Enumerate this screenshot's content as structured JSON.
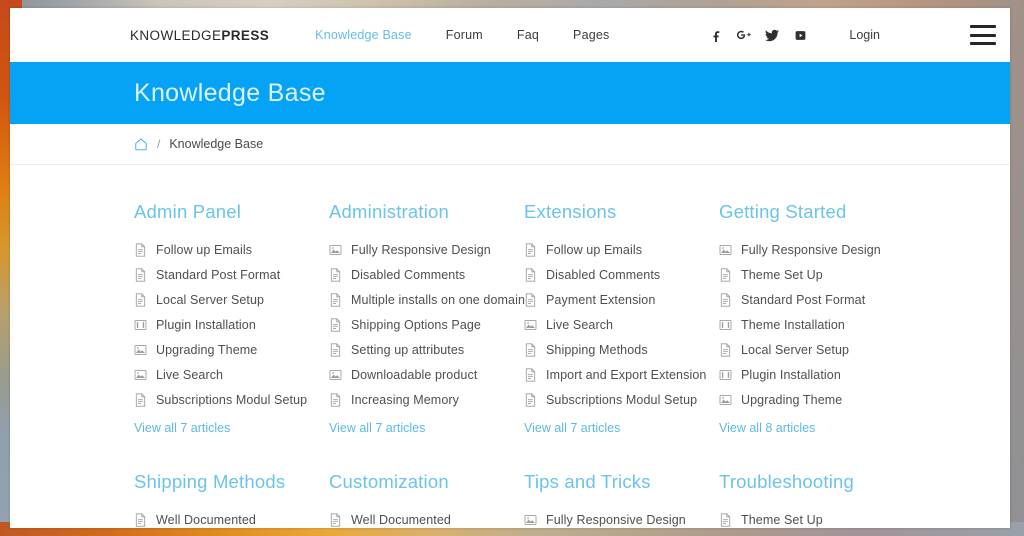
{
  "site": {
    "brand_light": "KNOWLEDGE",
    "brand_bold": "PRESS",
    "nav": [
      {
        "label": "Knowledge Base",
        "active": true
      },
      {
        "label": "Forum",
        "active": false
      },
      {
        "label": "Faq",
        "active": false
      },
      {
        "label": "Pages",
        "active": false
      }
    ],
    "socials": [
      {
        "name": "facebook-icon"
      },
      {
        "name": "google-plus-icon"
      },
      {
        "name": "twitter-icon"
      },
      {
        "name": "youtube-icon"
      }
    ],
    "login_label": "Login",
    "menu_icon": "hamburger-menu-icon"
  },
  "hero": {
    "title": "Knowledge Base"
  },
  "breadcrumb": {
    "home_icon": "home-icon",
    "separator": "/",
    "current": "Knowledge Base"
  },
  "colors": {
    "banner_blue": "#05A3F5",
    "heading_blue": "#6CC3EA",
    "link_blue": "#5CB9E5",
    "nav_active": "#62BDEC",
    "body_text": "#4F4F4F",
    "icon_grey": "#9D9D9D"
  },
  "categories": [
    {
      "title": "Admin Panel",
      "items": [
        {
          "label": "Follow up Emails",
          "icon": "document-icon"
        },
        {
          "label": "Standard Post Format",
          "icon": "document-icon"
        },
        {
          "label": "Local Server Setup",
          "icon": "document-icon"
        },
        {
          "label": "Plugin Installation",
          "icon": "plugin-icon"
        },
        {
          "label": "Upgrading Theme",
          "icon": "image-icon"
        },
        {
          "label": "Live Search",
          "icon": "image-icon"
        },
        {
          "label": "Subscriptions Modul Setup",
          "icon": "document-icon"
        }
      ],
      "view_all": "View all 7 articles"
    },
    {
      "title": "Administration",
      "items": [
        {
          "label": "Fully Responsive Design",
          "icon": "image-icon"
        },
        {
          "label": "Disabled Comments",
          "icon": "document-icon"
        },
        {
          "label": "Multiple installs on one domain",
          "icon": "document-icon"
        },
        {
          "label": "Shipping Options Page",
          "icon": "document-icon"
        },
        {
          "label": "Setting up attributes",
          "icon": "document-icon"
        },
        {
          "label": "Downloadable product",
          "icon": "image-icon"
        },
        {
          "label": "Increasing Memory",
          "icon": "document-icon"
        }
      ],
      "view_all": "View all 7 articles"
    },
    {
      "title": "Extensions",
      "items": [
        {
          "label": "Follow up Emails",
          "icon": "document-icon"
        },
        {
          "label": "Disabled Comments",
          "icon": "document-icon"
        },
        {
          "label": "Payment Extension",
          "icon": "document-icon"
        },
        {
          "label": "Live Search",
          "icon": "image-icon"
        },
        {
          "label": "Shipping Methods",
          "icon": "document-icon"
        },
        {
          "label": "Import and Export Extension",
          "icon": "document-icon"
        },
        {
          "label": "Subscriptions Modul Setup",
          "icon": "document-icon"
        }
      ],
      "view_all": "View all 7 articles"
    },
    {
      "title": "Getting Started",
      "items": [
        {
          "label": "Fully Responsive Design",
          "icon": "image-icon"
        },
        {
          "label": "Theme Set Up",
          "icon": "document-icon"
        },
        {
          "label": "Standard Post Format",
          "icon": "document-icon"
        },
        {
          "label": "Theme Installation",
          "icon": "plugin-icon"
        },
        {
          "label": "Local Server Setup",
          "icon": "document-icon"
        },
        {
          "label": "Plugin Installation",
          "icon": "plugin-icon"
        },
        {
          "label": "Upgrading Theme",
          "icon": "image-icon"
        }
      ],
      "view_all": "View all 8 articles"
    },
    {
      "title": "Shipping Methods",
      "items": [
        {
          "label": "Well Documented",
          "icon": "document-icon"
        }
      ],
      "view_all": ""
    },
    {
      "title": "Customization",
      "items": [
        {
          "label": "Well Documented",
          "icon": "document-icon"
        }
      ],
      "view_all": ""
    },
    {
      "title": "Tips and Tricks",
      "items": [
        {
          "label": "Fully Responsive Design",
          "icon": "image-icon"
        }
      ],
      "view_all": ""
    },
    {
      "title": "Troubleshooting",
      "items": [
        {
          "label": "Theme Set Up",
          "icon": "document-icon"
        }
      ],
      "view_all": ""
    }
  ]
}
